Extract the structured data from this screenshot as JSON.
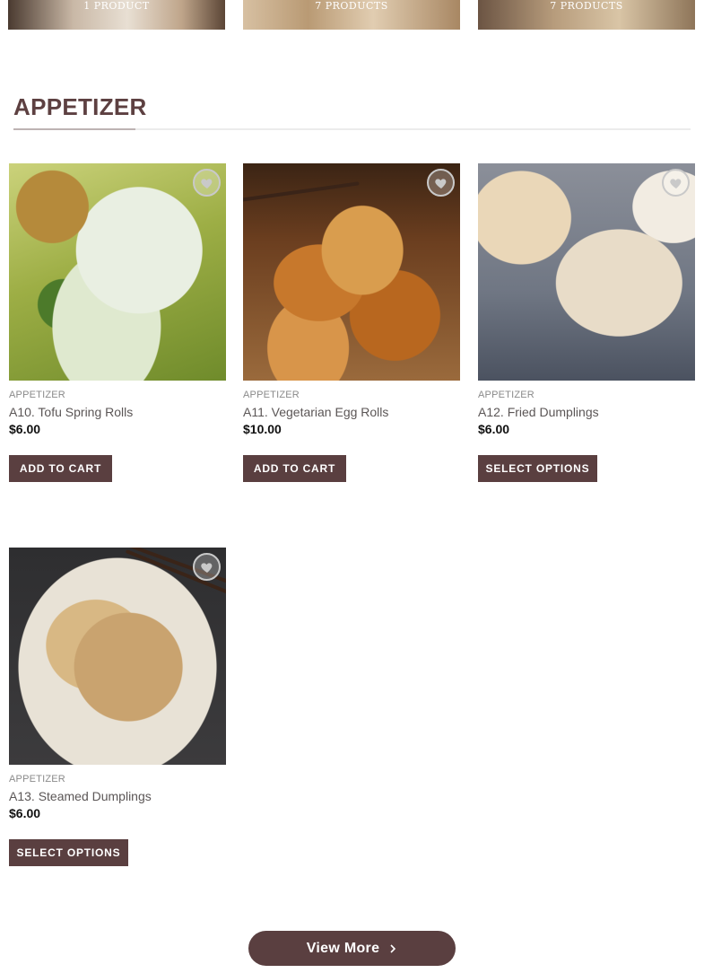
{
  "categories": [
    {
      "count_label": "1 PRODUCT"
    },
    {
      "count_label": "7 PRODUCTS"
    },
    {
      "count_label": "7 PRODUCTS"
    }
  ],
  "section": {
    "title": "APPETIZER"
  },
  "products": [
    {
      "category": "APPETIZER",
      "name": "A10. Tofu Spring Rolls",
      "price": "$6.00",
      "button": "ADD TO CART",
      "wishlist_icon": "heart-icon"
    },
    {
      "category": "APPETIZER",
      "name": "A11. Vegetarian Egg Rolls",
      "price": "$10.00",
      "button": "ADD TO CART",
      "wishlist_icon": "heart-icon"
    },
    {
      "category": "APPETIZER",
      "name": "A12. Fried Dumplings",
      "price": "$6.00",
      "button": "SELECT OPTIONS",
      "wishlist_icon": "heart-icon"
    },
    {
      "category": "APPETIZER",
      "name": "A13. Steamed Dumplings",
      "price": "$6.00",
      "button": "SELECT OPTIONS",
      "wishlist_icon": "heart-icon"
    }
  ],
  "view_more": {
    "label": "View More",
    "icon": "chevron-right-icon"
  },
  "colors": {
    "accent": "#5a3f40",
    "title": "#5d4041"
  }
}
